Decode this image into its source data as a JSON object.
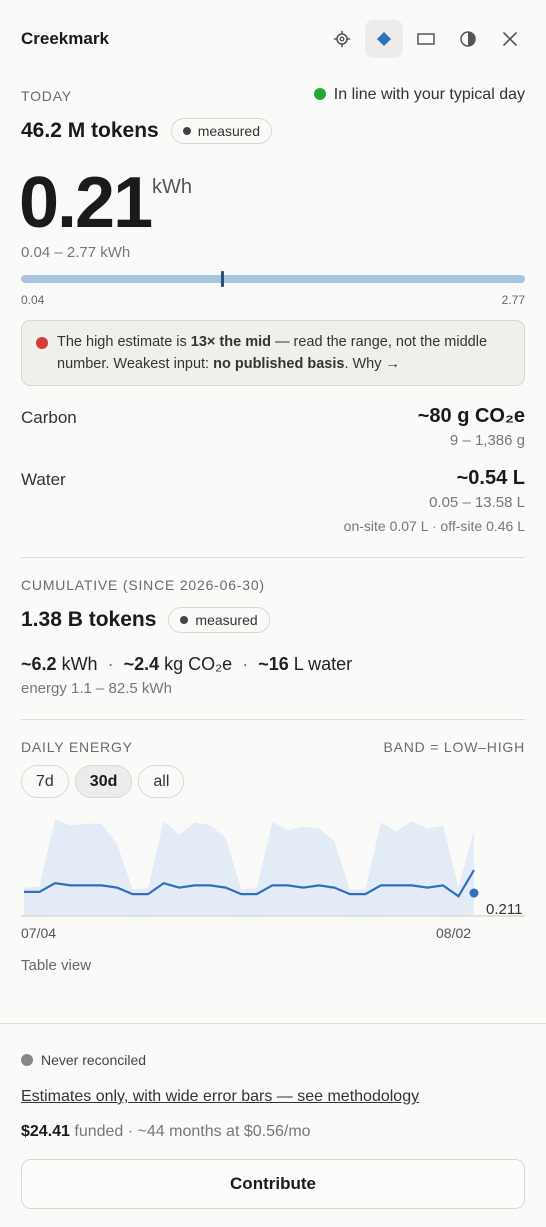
{
  "header": {
    "title": "Creekmark",
    "icons": [
      "gear-icon",
      "diamond-icon",
      "rectangle-icon",
      "contrast-icon",
      "close-icon"
    ]
  },
  "today": {
    "label": "TODAY",
    "status": "In line with your typical day",
    "status_color": "#22a832",
    "tokens": "46.2 M tokens",
    "tokens_badge": "measured",
    "energy_value": "0.21",
    "energy_unit": "kWh",
    "energy_range": "0.04 – 2.77 kWh",
    "range_min": "0.04",
    "range_max": "2.77",
    "range_mark_fraction": 0.4
  },
  "callout": {
    "text_1": "The high estimate is ",
    "bold_1": "13× the mid",
    "text_2": " — read the range, not the middle number. Weakest input: ",
    "bold_2": "no published basis",
    "text_3": ". Why →"
  },
  "carbon": {
    "label": "Carbon",
    "value": "~80 g CO₂e",
    "range": "9 – 1,386 g"
  },
  "water": {
    "label": "Water",
    "value": "~0.54 L",
    "range": "0.05 – 13.58 L",
    "breakdown": "on-site 0.07 L · off-site 0.46 L"
  },
  "cumulative": {
    "label": "CUMULATIVE (SINCE 2026-06-30)",
    "tokens": "1.38 B tokens",
    "tokens_badge": "measured",
    "energy_approx": "~6.2",
    "energy_unit": "kWh",
    "carbon_approx": "~2.4",
    "carbon_unit": "kg CO₂e",
    "water_approx": "~16",
    "water_unit": "L water",
    "separator": "·",
    "energy_range": "energy 1.1 – 82.5 kWh"
  },
  "daily_energy": {
    "label": "DAILY ENERGY",
    "band_label": "BAND = LOW–HIGH",
    "tabs": [
      "7d",
      "30d",
      "all"
    ],
    "active_tab": "30d",
    "x_start": "07/04",
    "x_end": "08/02",
    "last_value": "0.211",
    "table_view": "Table view"
  },
  "chart_data": {
    "type": "area",
    "x_start": "07/04",
    "x_end": "08/02",
    "mid": [
      0.11,
      0.11,
      0.15,
      0.14,
      0.14,
      0.14,
      0.13,
      0.1,
      0.1,
      0.15,
      0.13,
      0.14,
      0.14,
      0.13,
      0.1,
      0.1,
      0.14,
      0.14,
      0.13,
      0.14,
      0.13,
      0.1,
      0.1,
      0.14,
      0.14,
      0.14,
      0.13,
      0.14,
      0.09,
      0.21
    ],
    "high": [
      0.9,
      0.95,
      3.1,
      2.9,
      2.95,
      2.95,
      2.3,
      0.85,
      0.9,
      3.05,
      2.6,
      3.0,
      2.9,
      2.5,
      0.85,
      0.9,
      3.0,
      2.75,
      2.85,
      2.8,
      2.4,
      0.85,
      0.85,
      3.0,
      2.7,
      3.05,
      2.8,
      2.9,
      0.9,
      2.77
    ],
    "low": [
      0.02,
      0.02,
      0.03,
      0.03,
      0.03,
      0.03,
      0.03,
      0.02,
      0.02,
      0.03,
      0.03,
      0.03,
      0.03,
      0.03,
      0.02,
      0.02,
      0.03,
      0.03,
      0.03,
      0.03,
      0.03,
      0.02,
      0.02,
      0.03,
      0.03,
      0.03,
      0.03,
      0.03,
      0.02,
      0.04
    ],
    "colors": {
      "band": "#e3ecf6",
      "line": "#2f6fc0"
    }
  },
  "footer": {
    "reconcile_status": "Never reconciled",
    "reconcile_color": "#888888",
    "methodology_link": "Estimates only, with wide error bars — see methodology",
    "funded_amount": "$24.41",
    "funded_text": "funded · ~44 months at $0.56/mo",
    "contribute_label": "Contribute"
  }
}
